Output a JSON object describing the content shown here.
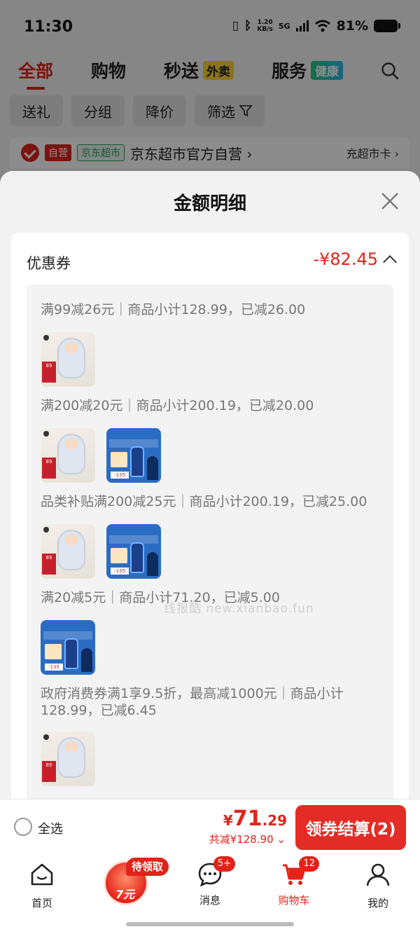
{
  "status_bar": {
    "time": "11:30",
    "speed": "1.20\nKB/s",
    "network": "5G",
    "battery_pct": "81%",
    "icons": [
      "vibrate-icon",
      "bluetooth-icon",
      "wifi-icon",
      "battery-icon"
    ]
  },
  "top_tabs": {
    "items": [
      {
        "label": "全部",
        "active": true
      },
      {
        "label": "购物"
      },
      {
        "label": "秒送",
        "tag": "外卖"
      },
      {
        "label": "服务",
        "tag": "健康"
      }
    ]
  },
  "filters": [
    "送礼",
    "分组",
    "降价",
    "筛选"
  ],
  "shop": {
    "tag_self": "自营",
    "tag_market": "京东超市",
    "name": "京东超市官方自营 ›",
    "right_link": "充超市卡 ›"
  },
  "sheet": {
    "title": "金额明细",
    "coupon_label": "优惠券",
    "coupon_amount": "-¥82.45",
    "rules": [
      {
        "text": "满99减26元｜商品小计128.99，已减26.00",
        "thumbs": [
          "baby"
        ]
      },
      {
        "text": "满200减20元｜商品小计200.19，已减20.00",
        "thumbs": [
          "baby",
          "clean"
        ]
      },
      {
        "text": "品类补贴满200减25元｜商品小计200.19，已减25.00",
        "thumbs": [
          "baby",
          "clean"
        ]
      },
      {
        "text": "满20减5元｜商品小计71.20，已减5.00",
        "thumbs": [
          "clean"
        ]
      },
      {
        "text": "政府消费券满1享9.5折，最高减1000元｜商品小计128.99，已减6.45",
        "thumbs": [
          "baby"
        ]
      }
    ],
    "thumb_text": {
      "baby_price": "89",
      "clean_price": "-135"
    },
    "watermark": "线报酷 new.xianbao.fun"
  },
  "checkout": {
    "select_all": "全选",
    "currency": "¥",
    "price_int": "71",
    "price_dec": ".29",
    "discount": "共减¥128.90 ⌄",
    "button": "领券结算(2)"
  },
  "bottom_nav": {
    "items": [
      {
        "label": "首页",
        "icon": "home-icon"
      },
      {
        "label": "",
        "icon": "red-packet-icon"
      },
      {
        "label": "消息",
        "icon": "message-icon",
        "badge": "5+"
      },
      {
        "label": "购物车",
        "icon": "cart-icon",
        "badge": "12",
        "active": true
      },
      {
        "label": "我的",
        "icon": "profile-icon"
      }
    ],
    "promo_pill": "待领取",
    "promo_amount": "7元"
  },
  "colors": {
    "accent": "#e2231a",
    "jd_green": "#2b9d5c",
    "tag_yellow": "#ffd23c"
  }
}
